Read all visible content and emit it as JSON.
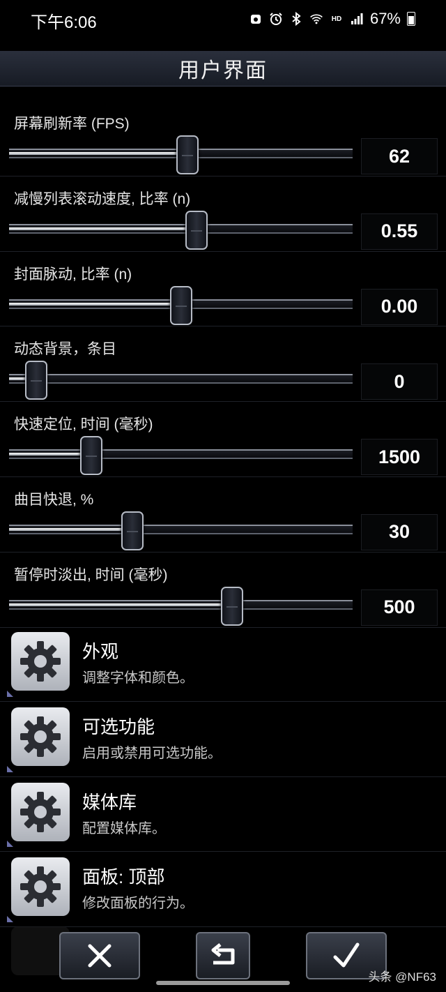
{
  "status_bar": {
    "time": "下午6:06",
    "network_label": "HD",
    "battery": "67%",
    "icons": [
      "app-notification-icon",
      "alarm-icon",
      "bluetooth-icon",
      "wifi-icon",
      "hd-icon",
      "cell-signal-icon",
      "battery-icon"
    ]
  },
  "header": {
    "title": "用户界面"
  },
  "sliders": [
    {
      "label": "屏幕刷新率 (FPS)",
      "value": "62",
      "position": 0.52
    },
    {
      "label": "减慢列表滚动速度, 比率 (n)",
      "value": "0.55",
      "position": 0.545
    },
    {
      "label": "封面脉动, 比率 (n)",
      "value": "0.00",
      "position": 0.5
    },
    {
      "label": "动态背景，条目",
      "value": "0",
      "position": 0.08
    },
    {
      "label": "快速定位, 时间 (毫秒)",
      "value": "1500",
      "position": 0.24
    },
    {
      "label": "曲目快退, %",
      "value": "30",
      "position": 0.36
    },
    {
      "label": "暂停时淡出, 时间 (毫秒)",
      "value": "500",
      "position": 0.65
    }
  ],
  "menu": [
    {
      "title": "外观",
      "subtitle": "调整字体和颜色。",
      "icon": "gear-icon"
    },
    {
      "title": "可选功能",
      "subtitle": "启用或禁用可选功能。",
      "icon": "gear-icon"
    },
    {
      "title": "媒体库",
      "subtitle": "配置媒体库。",
      "icon": "gear-icon"
    },
    {
      "title": "面板: 顶部",
      "subtitle": "修改面板的行为。",
      "icon": "gear-icon"
    }
  ],
  "bottom_bar": {
    "buttons": [
      {
        "name": "cancel-button",
        "icon": "close-icon"
      },
      {
        "name": "undo-button",
        "icon": "undo-icon"
      },
      {
        "name": "confirm-button",
        "icon": "check-icon"
      }
    ]
  },
  "watermark": "头条 @NF63"
}
